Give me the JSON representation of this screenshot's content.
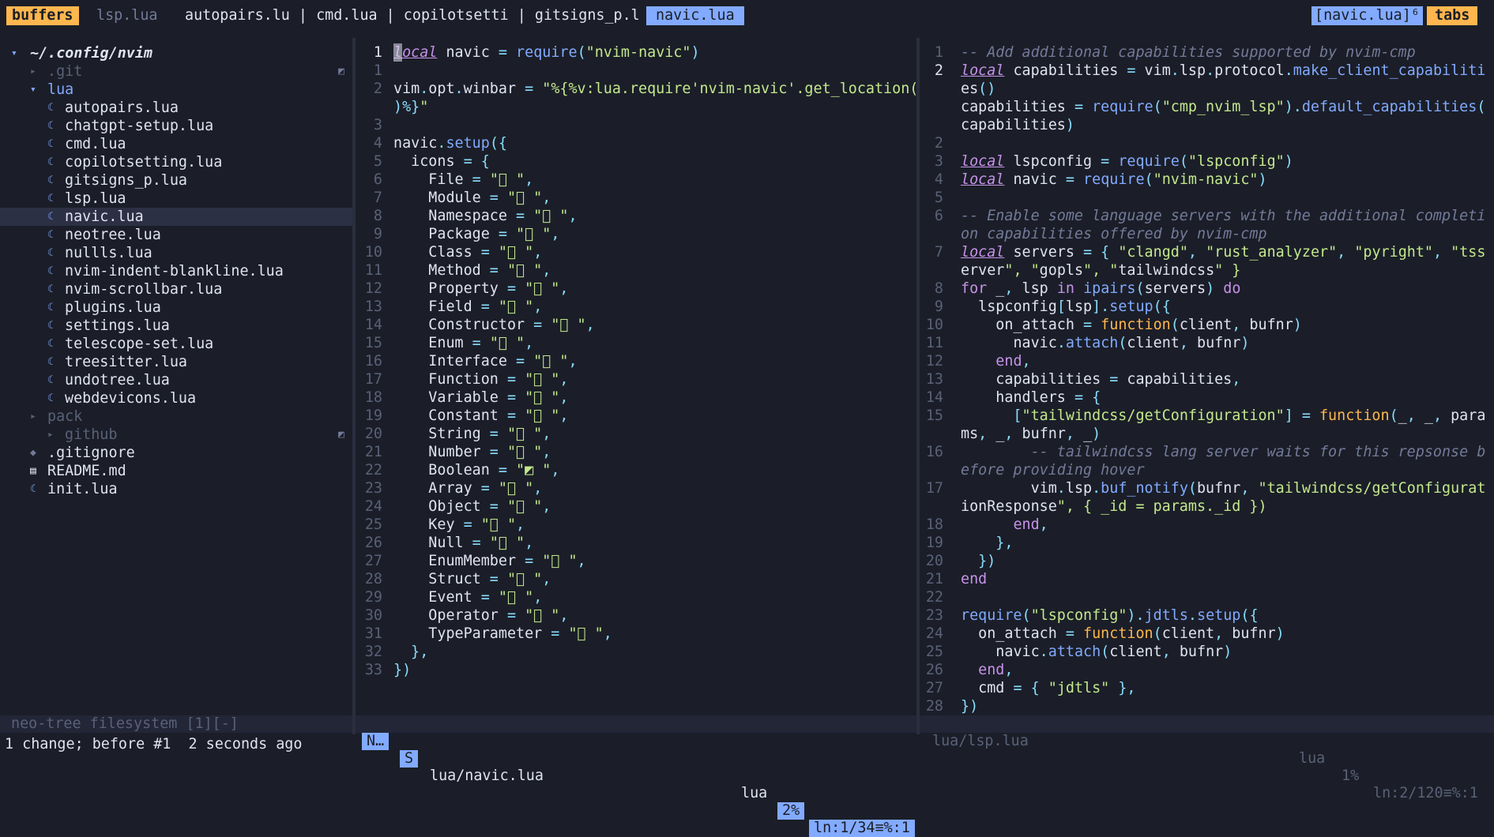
{
  "bufferline": {
    "buffers_label": "buffers",
    "tabs": [
      {
        "label": "lsp.lua",
        "state": "inactive"
      },
      {
        "label": "autopairs.lu | cmd.lua | copilotsetti | gitsigns_p.l",
        "state": "normal"
      },
      {
        "label": "navic.lua",
        "state": "active"
      }
    ],
    "tab_indicator": "[navic.lua]⁶",
    "tabs_label": "tabs"
  },
  "tree": {
    "root": "~/.config/nvim",
    "items": [
      {
        "label": ".git",
        "depth": 1,
        "type": "folder-closed",
        "dim": true,
        "git": true
      },
      {
        "label": "lua",
        "depth": 1,
        "type": "folder-open",
        "dim": false,
        "color": "#82aaff"
      },
      {
        "label": "autopairs.lua",
        "depth": 2,
        "type": "lua"
      },
      {
        "label": "chatgpt-setup.lua",
        "depth": 2,
        "type": "lua"
      },
      {
        "label": "cmd.lua",
        "depth": 2,
        "type": "lua"
      },
      {
        "label": "copilotsetting.lua",
        "depth": 2,
        "type": "lua"
      },
      {
        "label": "gitsigns_p.lua",
        "depth": 2,
        "type": "lua"
      },
      {
        "label": "lsp.lua",
        "depth": 2,
        "type": "lua"
      },
      {
        "label": "navic.lua",
        "depth": 2,
        "type": "lua",
        "selected": true
      },
      {
        "label": "neotree.lua",
        "depth": 2,
        "type": "lua"
      },
      {
        "label": "nullls.lua",
        "depth": 2,
        "type": "lua"
      },
      {
        "label": "nvim-indent-blankline.lua",
        "depth": 2,
        "type": "lua"
      },
      {
        "label": "nvim-scrollbar.lua",
        "depth": 2,
        "type": "lua"
      },
      {
        "label": "plugins.lua",
        "depth": 2,
        "type": "lua"
      },
      {
        "label": "settings.lua",
        "depth": 2,
        "type": "lua"
      },
      {
        "label": "telescope-set.lua",
        "depth": 2,
        "type": "lua"
      },
      {
        "label": "treesitter.lua",
        "depth": 2,
        "type": "lua"
      },
      {
        "label": "undotree.lua",
        "depth": 2,
        "type": "lua"
      },
      {
        "label": "webdevicons.lua",
        "depth": 2,
        "type": "lua"
      },
      {
        "label": "pack",
        "depth": 1,
        "type": "folder-closed",
        "dim": true
      },
      {
        "label": "github",
        "depth": 2,
        "type": "folder-closed",
        "dim": true,
        "git": true
      },
      {
        "label": ".gitignore",
        "depth": 1,
        "type": "git"
      },
      {
        "label": "README.md",
        "depth": 1,
        "type": "md"
      },
      {
        "label": "init.lua",
        "depth": 1,
        "type": "lua"
      }
    ]
  },
  "left_editor": {
    "lines": [
      {
        "n": "1",
        "cur": true,
        "t": "local navic = require(\"nvim-navic\")"
      },
      {
        "n": "1",
        "t": ""
      },
      {
        "n": "2",
        "t": "vim.opt.winbar = \"%{%v:lua.require'nvim-navic'.get_location("
      },
      {
        "n": "",
        "t": ")%}\""
      },
      {
        "n": "3",
        "t": ""
      },
      {
        "n": "4",
        "t": "navic.setup({"
      },
      {
        "n": "5",
        "t": "  icons = {"
      },
      {
        "n": "6",
        "t": "    File = \"󰈙 \","
      },
      {
        "n": "7",
        "t": "    Module = \"󰆧 \","
      },
      {
        "n": "8",
        "t": "    Namespace = \"󰌗 \","
      },
      {
        "n": "9",
        "t": "    Package = \"󰏖 \","
      },
      {
        "n": "10",
        "t": "    Class = \"󰠱 \","
      },
      {
        "n": "11",
        "t": "    Method = \"󰆧 \","
      },
      {
        "n": "12",
        "t": "    Property = \"󰜢 \","
      },
      {
        "n": "13",
        "t": "    Field = \"󰆧 \","
      },
      {
        "n": "14",
        "t": "    Constructor = \"󰆧 \","
      },
      {
        "n": "15",
        "t": "    Enum = \"󰒻 \","
      },
      {
        "n": "16",
        "t": "    Interface = \"󰕘 \","
      },
      {
        "n": "17",
        "t": "    Function = \"󰊕 \","
      },
      {
        "n": "18",
        "t": "    Variable = \"󰆧 \","
      },
      {
        "n": "19",
        "t": "    Constant = \"󰏿 \","
      },
      {
        "n": "20",
        "t": "    String = \"󰀬 \","
      },
      {
        "n": "21",
        "t": "    Number = \"󰎠 \","
      },
      {
        "n": "22",
        "t": "    Boolean = \"◩ \","
      },
      {
        "n": "23",
        "t": "    Array = \"󰅪 \","
      },
      {
        "n": "24",
        "t": "    Object = \"󰅩 \","
      },
      {
        "n": "25",
        "t": "    Key = \"󰌋 \","
      },
      {
        "n": "26",
        "t": "    Null = \"󰟢 \","
      },
      {
        "n": "27",
        "t": "    EnumMember = \"󰒻 \","
      },
      {
        "n": "28",
        "t": "    Struct = \"󰌗 \","
      },
      {
        "n": "29",
        "t": "    Event = \"󰉁 \","
      },
      {
        "n": "30",
        "t": "    Operator = \"󰆕 \","
      },
      {
        "n": "31",
        "t": "    TypeParameter = \"󰊄 \","
      },
      {
        "n": "32",
        "t": "  },"
      },
      {
        "n": "33",
        "t": "})"
      }
    ]
  },
  "right_editor": {
    "lines": [
      {
        "n": "1",
        "t": "-- Add additional capabilities supported by nvim-cmp"
      },
      {
        "n": "2",
        "cur": true,
        "t": "local capabilities = vim.lsp.protocol.make_client_capabiliti"
      },
      {
        "n": "",
        "t": "es()"
      },
      {
        "n": "",
        "t": "capabilities = require(\"cmp_nvim_lsp\").default_capabilities("
      },
      {
        "n": "",
        "t": "capabilities)"
      },
      {
        "n": "2",
        "t": ""
      },
      {
        "n": "3",
        "t": "local lspconfig = require(\"lspconfig\")"
      },
      {
        "n": "4",
        "t": "local navic = require(\"nvim-navic\")"
      },
      {
        "n": "5",
        "t": ""
      },
      {
        "n": "6",
        "t": "-- Enable some language servers with the additional completi"
      },
      {
        "n": "",
        "t": "on capabilities offered by nvim-cmp"
      },
      {
        "n": "7",
        "t": "local servers = { \"clangd\", \"rust_analyzer\", \"pyright\", \"tss"
      },
      {
        "n": "",
        "t": "erver\", \"gopls\", \"tailwindcss\" }"
      },
      {
        "n": "8",
        "t": "for _, lsp in ipairs(servers) do"
      },
      {
        "n": "9",
        "t": "  lspconfig[lsp].setup({"
      },
      {
        "n": "10",
        "t": "    on_attach = function(client, bufnr)"
      },
      {
        "n": "11",
        "t": "      navic.attach(client, bufnr)"
      },
      {
        "n": "12",
        "t": "    end,"
      },
      {
        "n": "13",
        "t": "    capabilities = capabilities,"
      },
      {
        "n": "14",
        "t": "    handlers = {"
      },
      {
        "n": "15",
        "t": "      [\"tailwindcss/getConfiguration\"] = function(_, _, para"
      },
      {
        "n": "",
        "t": "ms, _, bufnr, _)"
      },
      {
        "n": "16",
        "t": "        -- tailwindcss lang server waits for this repsonse b"
      },
      {
        "n": "",
        "t": "efore providing hover"
      },
      {
        "n": "17",
        "t": "        vim.lsp.buf_notify(bufnr, \"tailwindcss/getConfigurat"
      },
      {
        "n": "",
        "t": "ionResponse\", { _id = params._id })"
      },
      {
        "n": "18",
        "t": "      end,"
      },
      {
        "n": "19",
        "t": "    },"
      },
      {
        "n": "20",
        "t": "  })"
      },
      {
        "n": "21",
        "t": "end"
      },
      {
        "n": "22",
        "t": ""
      },
      {
        "n": "23",
        "t": "require(\"lspconfig\").jdtls.setup({"
      },
      {
        "n": "24",
        "t": "  on_attach = function(client, bufnr)"
      },
      {
        "n": "25",
        "t": "    navic.attach(client, bufnr)"
      },
      {
        "n": "26",
        "t": "  end,"
      },
      {
        "n": "27",
        "t": "  cmd = { \"jdtls\" },"
      },
      {
        "n": "28",
        "t": "})"
      }
    ]
  },
  "status": {
    "tree": "neo-tree filesystem [1][-]",
    "left_mode": "N…",
    "left_mode2": "S",
    "left_file": "lua/navic.lua",
    "left_ft": "lua",
    "left_pct": "2%",
    "left_pos": "ln:1/34≡%:1",
    "right_file": "lua/lsp.lua",
    "right_ft": "lua",
    "right_pct": "1%",
    "right_pos": "ln:2/120≡%:1"
  },
  "cmdline": "1 change; before #1  2 seconds ago",
  "colors": {
    "background": "#1b1e28",
    "accent_blue": "#82aaff",
    "accent_orange": "#ffb64e",
    "keyword": "#c792ea",
    "string": "#c3e88d",
    "comment": "#737a99"
  }
}
